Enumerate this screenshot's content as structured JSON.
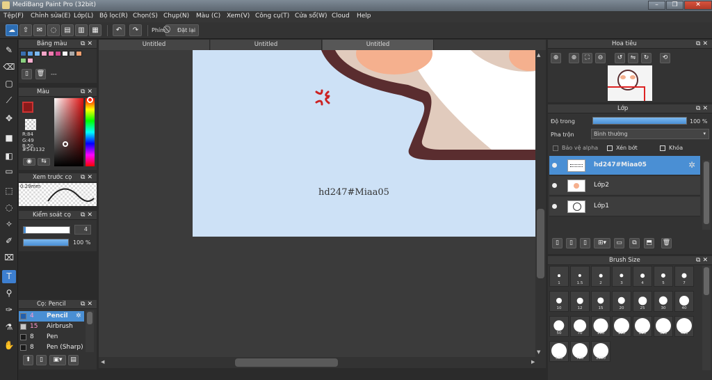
{
  "window": {
    "title": "MediBang Paint Pro (32bit)",
    "minimize": "–",
    "restore": "❐",
    "close": "✕"
  },
  "menu": [
    "Tệp(F)",
    "Chỉnh sửa(E)",
    "Lớp(L)",
    "Bộ lọc(R)",
    "Chọn(S)",
    "Chụp(N)",
    "Màu (C)",
    "Xem(V)",
    "Công cụ(T)",
    "Cửa sổ(W)",
    "Cloud",
    "Help"
  ],
  "toolbar": {
    "shortcut_label": "Phím",
    "reset_label": "Đặt lại"
  },
  "tabs": [
    "Untitled",
    "Untitled",
    "Untitled"
  ],
  "panels": {
    "palette": {
      "title": "Bảng màu",
      "name_value": "---",
      "swatches": [
        "#3a6fb0",
        "#5a9be0",
        "#7cb9f0",
        "#f4a6c8",
        "#ee7cb0",
        "#d04a8f",
        "#f6f6f6",
        "#a9a9a9",
        "#f0a070",
        "#8ad080",
        "#f6b0d0"
      ]
    },
    "color": {
      "title": "Màu",
      "r": "R:84",
      "g": "G:49",
      "b": "B:50",
      "hex": "#543132"
    },
    "brush_preview": {
      "title": "Xem trước cọ",
      "size": "0.29mm"
    },
    "brush_control": {
      "title": "Kiểm soát cọ",
      "size": "4",
      "opacity": "100 %"
    },
    "brush_list": {
      "title": "Cọ: Pencil",
      "items": [
        {
          "size": "4",
          "name": "Pencil",
          "color": "#2060b0"
        },
        {
          "size": "15",
          "name": "Airbrush",
          "color": "#c8c8c8"
        },
        {
          "size": "8",
          "name": "Pen",
          "color": "#1a1a1a"
        },
        {
          "size": "8",
          "name": "Pen (Sharp)",
          "color": "#1a1a1a"
        }
      ]
    },
    "navigator": {
      "title": "Hoa tiêu"
    },
    "layer": {
      "title": "Lớp",
      "opacity_label": "Độ trong",
      "opacity_value": "100 %",
      "blend_label": "Pha trộn",
      "blend_value": "Bình thường",
      "protect_alpha": "Bảo vệ alpha",
      "clipping": "Xén bớt",
      "lock": "Khóa",
      "layers": [
        "hd247#Miaa05",
        "Lớp2",
        "Lớp1"
      ]
    },
    "brush_size": {
      "title": "Brush Size",
      "sizes": [
        "1",
        "1.5",
        "2",
        "3",
        "4",
        "5",
        "7",
        "10",
        "12",
        "15",
        "20",
        "25",
        "30",
        "40",
        "50",
        "70",
        "100",
        "150",
        "200",
        "300",
        "400",
        "500",
        "700",
        "1000"
      ]
    }
  },
  "canvas": {
    "text": "hd247#Miaa05",
    "bg_color": "#cde1f6",
    "outline_color": "#5a2d2f",
    "anger_color": "#cc2222"
  }
}
